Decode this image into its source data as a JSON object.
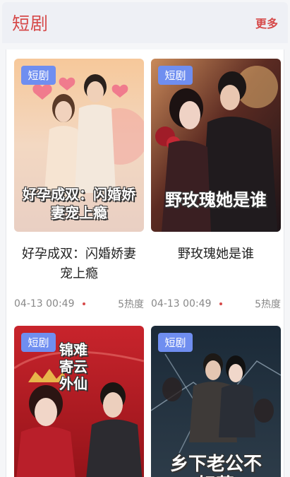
{
  "header": {
    "title": "短剧",
    "more": "更多"
  },
  "cards": [
    {
      "tag": "短剧",
      "poster_text": "好孕成双：闪婚娇妻宠上瘾",
      "title": "好孕成双：闪婚娇妻宠上瘾",
      "date": "04-13 00:49",
      "heat": "5热度"
    },
    {
      "tag": "短剧",
      "poster_text": "野玫瑰她是谁",
      "title": "野玫瑰她是谁",
      "date": "04-13 00:49",
      "heat": "5热度"
    },
    {
      "tag": "短剧",
      "poster_text": "锦难寄云外仙",
      "title": "",
      "date": "",
      "heat": ""
    },
    {
      "tag": "短剧",
      "poster_text": "乡下老公不好惹",
      "title": "",
      "date": "",
      "heat": ""
    }
  ],
  "colors": {
    "accent": "#d64a4a",
    "tag_bg": "#6f8ef0"
  }
}
